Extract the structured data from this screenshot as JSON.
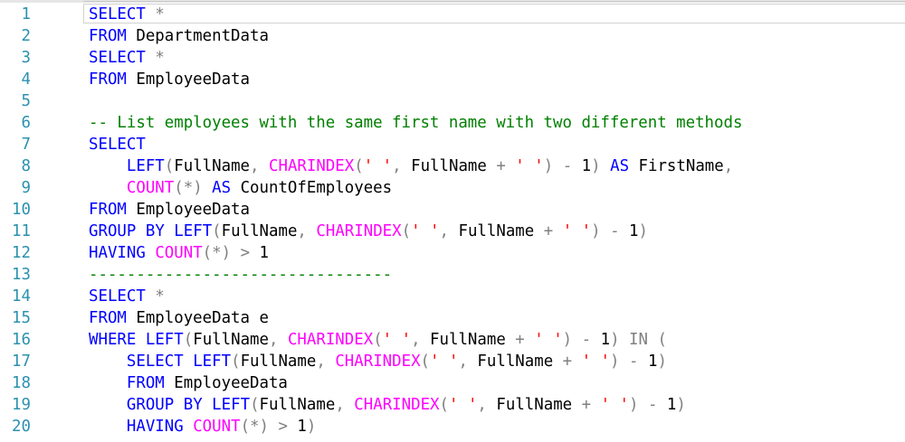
{
  "colors": {
    "keyword": "#0000ff",
    "function": "#ff00ff",
    "string": "#ff0000",
    "comment": "#008000",
    "operator": "#808080",
    "identifier": "#000000",
    "line_number": "#2b91af"
  },
  "editor": {
    "lines": [
      {
        "n": "1",
        "tokens": [
          {
            "t": "kw",
            "v": "SELECT"
          },
          {
            "t": "id",
            "v": " "
          },
          {
            "t": "op",
            "v": "*"
          }
        ]
      },
      {
        "n": "2",
        "tokens": [
          {
            "t": "kw",
            "v": "FROM"
          },
          {
            "t": "id",
            "v": " DepartmentData"
          }
        ]
      },
      {
        "n": "3",
        "tokens": [
          {
            "t": "kw",
            "v": "SELECT"
          },
          {
            "t": "id",
            "v": " "
          },
          {
            "t": "op",
            "v": "*"
          }
        ]
      },
      {
        "n": "4",
        "tokens": [
          {
            "t": "kw",
            "v": "FROM"
          },
          {
            "t": "id",
            "v": " EmployeeData"
          }
        ]
      },
      {
        "n": "5",
        "tokens": []
      },
      {
        "n": "6",
        "tokens": [
          {
            "t": "cm",
            "v": "-- List employees with the same first name with two different methods"
          }
        ]
      },
      {
        "n": "7",
        "tokens": [
          {
            "t": "kw",
            "v": "SELECT"
          }
        ]
      },
      {
        "n": "8",
        "tokens": [
          {
            "t": "id",
            "v": "    "
          },
          {
            "t": "kw",
            "v": "LEFT"
          },
          {
            "t": "op",
            "v": "("
          },
          {
            "t": "id",
            "v": "FullName"
          },
          {
            "t": "op",
            "v": ","
          },
          {
            "t": "id",
            "v": " "
          },
          {
            "t": "fn",
            "v": "CHARINDEX"
          },
          {
            "t": "op",
            "v": "("
          },
          {
            "t": "str",
            "v": "' '"
          },
          {
            "t": "op",
            "v": ","
          },
          {
            "t": "id",
            "v": " FullName "
          },
          {
            "t": "op",
            "v": "+"
          },
          {
            "t": "id",
            "v": " "
          },
          {
            "t": "str",
            "v": "' '"
          },
          {
            "t": "op",
            "v": ")"
          },
          {
            "t": "id",
            "v": " "
          },
          {
            "t": "op",
            "v": "-"
          },
          {
            "t": "id",
            "v": " 1"
          },
          {
            "t": "op",
            "v": ")"
          },
          {
            "t": "id",
            "v": " "
          },
          {
            "t": "kw",
            "v": "AS"
          },
          {
            "t": "id",
            "v": " FirstName"
          },
          {
            "t": "op",
            "v": ","
          }
        ]
      },
      {
        "n": "9",
        "tokens": [
          {
            "t": "id",
            "v": "    "
          },
          {
            "t": "fn",
            "v": "COUNT"
          },
          {
            "t": "op",
            "v": "(*)"
          },
          {
            "t": "id",
            "v": " "
          },
          {
            "t": "kw",
            "v": "AS"
          },
          {
            "t": "id",
            "v": " CountOfEmployees"
          }
        ]
      },
      {
        "n": "10",
        "tokens": [
          {
            "t": "kw",
            "v": "FROM"
          },
          {
            "t": "id",
            "v": " EmployeeData"
          }
        ]
      },
      {
        "n": "11",
        "tokens": [
          {
            "t": "kw",
            "v": "GROUP"
          },
          {
            "t": "id",
            "v": " "
          },
          {
            "t": "kw",
            "v": "BY"
          },
          {
            "t": "id",
            "v": " "
          },
          {
            "t": "kw",
            "v": "LEFT"
          },
          {
            "t": "op",
            "v": "("
          },
          {
            "t": "id",
            "v": "FullName"
          },
          {
            "t": "op",
            "v": ","
          },
          {
            "t": "id",
            "v": " "
          },
          {
            "t": "fn",
            "v": "CHARINDEX"
          },
          {
            "t": "op",
            "v": "("
          },
          {
            "t": "str",
            "v": "' '"
          },
          {
            "t": "op",
            "v": ","
          },
          {
            "t": "id",
            "v": " FullName "
          },
          {
            "t": "op",
            "v": "+"
          },
          {
            "t": "id",
            "v": " "
          },
          {
            "t": "str",
            "v": "' '"
          },
          {
            "t": "op",
            "v": ")"
          },
          {
            "t": "id",
            "v": " "
          },
          {
            "t": "op",
            "v": "-"
          },
          {
            "t": "id",
            "v": " 1"
          },
          {
            "t": "op",
            "v": ")"
          }
        ]
      },
      {
        "n": "12",
        "tokens": [
          {
            "t": "kw",
            "v": "HAVING"
          },
          {
            "t": "id",
            "v": " "
          },
          {
            "t": "fn",
            "v": "COUNT"
          },
          {
            "t": "op",
            "v": "(*)"
          },
          {
            "t": "id",
            "v": " "
          },
          {
            "t": "op",
            "v": ">"
          },
          {
            "t": "id",
            "v": " 1"
          }
        ]
      },
      {
        "n": "13",
        "tokens": [
          {
            "t": "cm",
            "v": "--------------------------------"
          }
        ]
      },
      {
        "n": "14",
        "tokens": [
          {
            "t": "kw",
            "v": "SELECT"
          },
          {
            "t": "id",
            "v": " "
          },
          {
            "t": "op",
            "v": "*"
          }
        ]
      },
      {
        "n": "15",
        "tokens": [
          {
            "t": "kw",
            "v": "FROM"
          },
          {
            "t": "id",
            "v": " EmployeeData e"
          }
        ]
      },
      {
        "n": "16",
        "tokens": [
          {
            "t": "kw",
            "v": "WHERE"
          },
          {
            "t": "id",
            "v": " "
          },
          {
            "t": "kw",
            "v": "LEFT"
          },
          {
            "t": "op",
            "v": "("
          },
          {
            "t": "id",
            "v": "FullName"
          },
          {
            "t": "op",
            "v": ","
          },
          {
            "t": "id",
            "v": " "
          },
          {
            "t": "fn",
            "v": "CHARINDEX"
          },
          {
            "t": "op",
            "v": "("
          },
          {
            "t": "str",
            "v": "' '"
          },
          {
            "t": "op",
            "v": ","
          },
          {
            "t": "id",
            "v": " FullName "
          },
          {
            "t": "op",
            "v": "+"
          },
          {
            "t": "id",
            "v": " "
          },
          {
            "t": "str",
            "v": "' '"
          },
          {
            "t": "op",
            "v": ")"
          },
          {
            "t": "id",
            "v": " "
          },
          {
            "t": "op",
            "v": "-"
          },
          {
            "t": "id",
            "v": " 1"
          },
          {
            "t": "op",
            "v": ")"
          },
          {
            "t": "id",
            "v": " "
          },
          {
            "t": "op",
            "v": "IN"
          },
          {
            "t": "id",
            "v": " "
          },
          {
            "t": "op",
            "v": "("
          }
        ]
      },
      {
        "n": "17",
        "tokens": [
          {
            "t": "id",
            "v": "    "
          },
          {
            "t": "kw",
            "v": "SELECT"
          },
          {
            "t": "id",
            "v": " "
          },
          {
            "t": "kw",
            "v": "LEFT"
          },
          {
            "t": "op",
            "v": "("
          },
          {
            "t": "id",
            "v": "FullName"
          },
          {
            "t": "op",
            "v": ","
          },
          {
            "t": "id",
            "v": " "
          },
          {
            "t": "fn",
            "v": "CHARINDEX"
          },
          {
            "t": "op",
            "v": "("
          },
          {
            "t": "str",
            "v": "' '"
          },
          {
            "t": "op",
            "v": ","
          },
          {
            "t": "id",
            "v": " FullName "
          },
          {
            "t": "op",
            "v": "+"
          },
          {
            "t": "id",
            "v": " "
          },
          {
            "t": "str",
            "v": "' '"
          },
          {
            "t": "op",
            "v": ")"
          },
          {
            "t": "id",
            "v": " "
          },
          {
            "t": "op",
            "v": "-"
          },
          {
            "t": "id",
            "v": " 1"
          },
          {
            "t": "op",
            "v": ")"
          }
        ]
      },
      {
        "n": "18",
        "tokens": [
          {
            "t": "id",
            "v": "    "
          },
          {
            "t": "kw",
            "v": "FROM"
          },
          {
            "t": "id",
            "v": " EmployeeData"
          }
        ]
      },
      {
        "n": "19",
        "tokens": [
          {
            "t": "id",
            "v": "    "
          },
          {
            "t": "kw",
            "v": "GROUP"
          },
          {
            "t": "id",
            "v": " "
          },
          {
            "t": "kw",
            "v": "BY"
          },
          {
            "t": "id",
            "v": " "
          },
          {
            "t": "kw",
            "v": "LEFT"
          },
          {
            "t": "op",
            "v": "("
          },
          {
            "t": "id",
            "v": "FullName"
          },
          {
            "t": "op",
            "v": ","
          },
          {
            "t": "id",
            "v": " "
          },
          {
            "t": "fn",
            "v": "CHARINDEX"
          },
          {
            "t": "op",
            "v": "("
          },
          {
            "t": "str",
            "v": "' '"
          },
          {
            "t": "op",
            "v": ","
          },
          {
            "t": "id",
            "v": " FullName "
          },
          {
            "t": "op",
            "v": "+"
          },
          {
            "t": "id",
            "v": " "
          },
          {
            "t": "str",
            "v": "' '"
          },
          {
            "t": "op",
            "v": ")"
          },
          {
            "t": "id",
            "v": " "
          },
          {
            "t": "op",
            "v": "-"
          },
          {
            "t": "id",
            "v": " 1"
          },
          {
            "t": "op",
            "v": ")"
          }
        ]
      },
      {
        "n": "20",
        "tokens": [
          {
            "t": "id",
            "v": "    "
          },
          {
            "t": "kw",
            "v": "HAVING"
          },
          {
            "t": "id",
            "v": " "
          },
          {
            "t": "fn",
            "v": "COUNT"
          },
          {
            "t": "op",
            "v": "(*)"
          },
          {
            "t": "id",
            "v": " "
          },
          {
            "t": "op",
            "v": ">"
          },
          {
            "t": "id",
            "v": " 1"
          },
          {
            "t": "op",
            "v": ")"
          }
        ]
      }
    ]
  }
}
